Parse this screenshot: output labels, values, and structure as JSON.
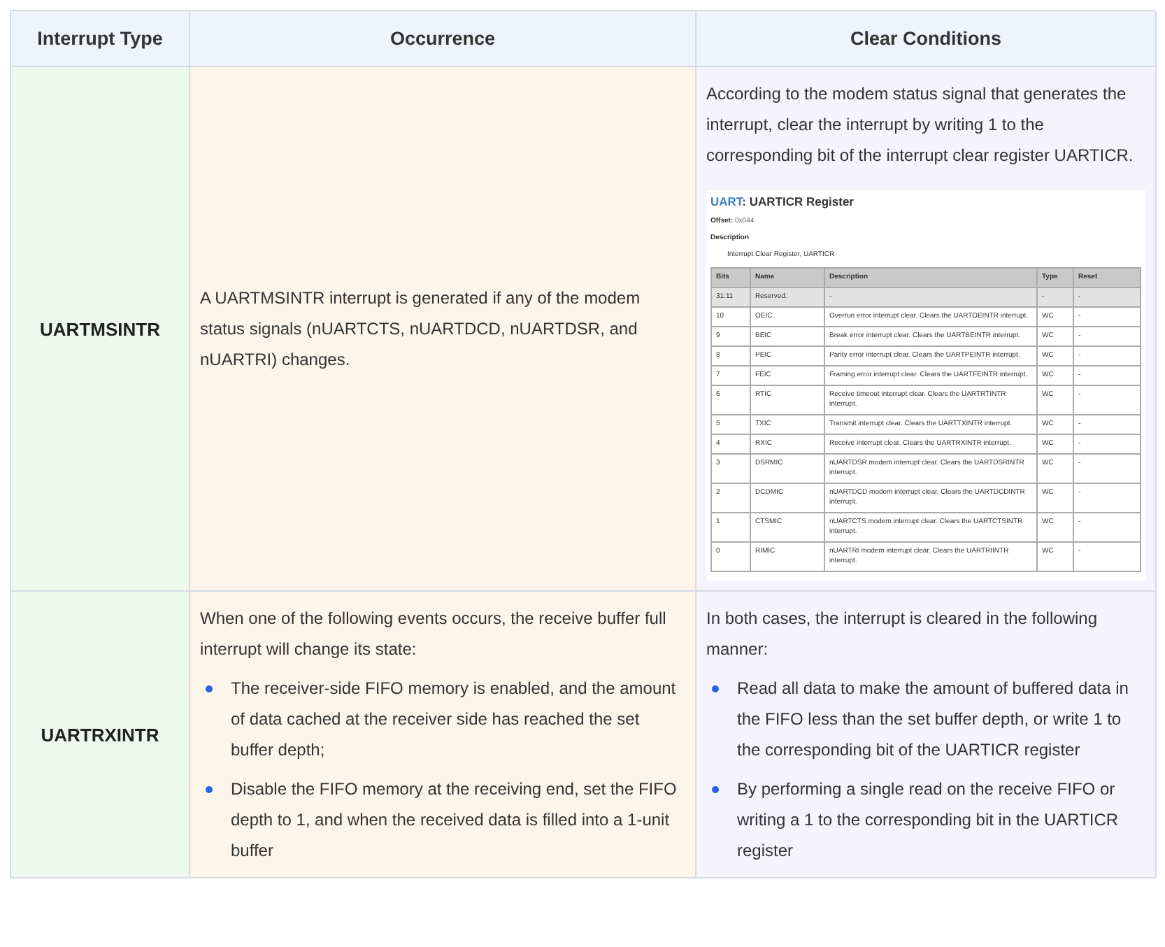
{
  "table": {
    "columns": [
      "Interrupt Type",
      "Occurrence",
      "Clear Conditions"
    ],
    "rows": [
      {
        "interrupt_type": "UARTMSINTR",
        "occurrence": {
          "text": "A UARTMSINTR interrupt is generated if any of the modem status signals (nUARTCTS, nUARTDCD, nUARTDSR, and nUARTRI) changes."
        },
        "clear_conditions": {
          "text": "According to the modem status signal that generates the interrupt, clear the interrupt by writing 1 to the corresponding bit of the interrupt clear register UARTICR.",
          "register_doc": {
            "module": "UART",
            "title": ": UARTICR Register",
            "offset_label": "Offset:",
            "offset": "0x044",
            "description_label": "Description",
            "description": "Interrupt Clear Register, UARTICR",
            "columns": [
              "Bits",
              "Name",
              "Description",
              "Type",
              "Reset"
            ],
            "rows": [
              {
                "reserved": true,
                "cells": [
                  "31:11",
                  "Reserved.",
                  "-",
                  "-",
                  "-"
                ]
              },
              {
                "reserved": false,
                "cells": [
                  "10",
                  "OEIC",
                  "Overrun error interrupt clear. Clears the UARTOEINTR interrupt.",
                  "WC",
                  "-"
                ]
              },
              {
                "reserved": false,
                "cells": [
                  "9",
                  "BEIC",
                  "Break error interrupt clear. Clears the UARTBEINTR interrupt.",
                  "WC",
                  "-"
                ]
              },
              {
                "reserved": false,
                "cells": [
                  "8",
                  "PEIC",
                  "Parity error interrupt clear. Clears the UARTPEINTR interrupt.",
                  "WC",
                  "-"
                ]
              },
              {
                "reserved": false,
                "cells": [
                  "7",
                  "FEIC",
                  "Framing error interrupt clear. Clears the UARTFEINTR interrupt.",
                  "WC",
                  "-"
                ]
              },
              {
                "reserved": false,
                "cells": [
                  "6",
                  "RTIC",
                  "Receive timeout interrupt clear. Clears the UARTRTINTR interrupt.",
                  "WC",
                  "-"
                ]
              },
              {
                "reserved": false,
                "cells": [
                  "5",
                  "TXIC",
                  "Transmit interrupt clear. Clears the UARTTXINTR interrupt.",
                  "WC",
                  "-"
                ]
              },
              {
                "reserved": false,
                "cells": [
                  "4",
                  "RXIC",
                  "Receive interrupt clear. Clears the UARTRXINTR interrupt.",
                  "WC",
                  "-"
                ]
              },
              {
                "reserved": false,
                "cells": [
                  "3",
                  "DSRMIC",
                  "nUARTDSR modem interrupt clear. Clears the UARTDSRINTR interrupt.",
                  "WC",
                  "-"
                ]
              },
              {
                "reserved": false,
                "cells": [
                  "2",
                  "DCDMIC",
                  "nUARTDCD modem interrupt clear. Clears the UARTDCDINTR interrupt.",
                  "WC",
                  "-"
                ]
              },
              {
                "reserved": false,
                "cells": [
                  "1",
                  "CTSMIC",
                  "nUARTCTS modem interrupt clear. Clears the UARTCTSINTR interrupt.",
                  "WC",
                  "-"
                ]
              },
              {
                "reserved": false,
                "cells": [
                  "0",
                  "RIMIC",
                  "nUARTRI modem interrupt clear. Clears the UARTRIINTR interrupt.",
                  "WC",
                  "-"
                ]
              }
            ]
          }
        }
      },
      {
        "interrupt_type": "UARTRXINTR",
        "occurrence": {
          "text": "When one of the following events occurs, the receive buffer full interrupt will change its state:",
          "bullets": [
            "The receiver-side FIFO memory is enabled, and the amount of data cached at the receiver side has reached the set buffer depth;",
            "Disable the FIFO memory at the receiving end, set the FIFO depth to 1, and when the received data is filled into a 1-unit buffer"
          ]
        },
        "clear_conditions": {
          "text": "In both cases, the interrupt is cleared in the following manner:",
          "bullets": [
            "Read all data to make the amount of buffered data in the FIFO less than the set buffer depth, or write 1 to the corresponding bit of the UARTICR register",
            "By performing a single read on the receive FIFO or writing a 1 to the corresponding bit in the UARTICR register"
          ]
        }
      }
    ]
  }
}
